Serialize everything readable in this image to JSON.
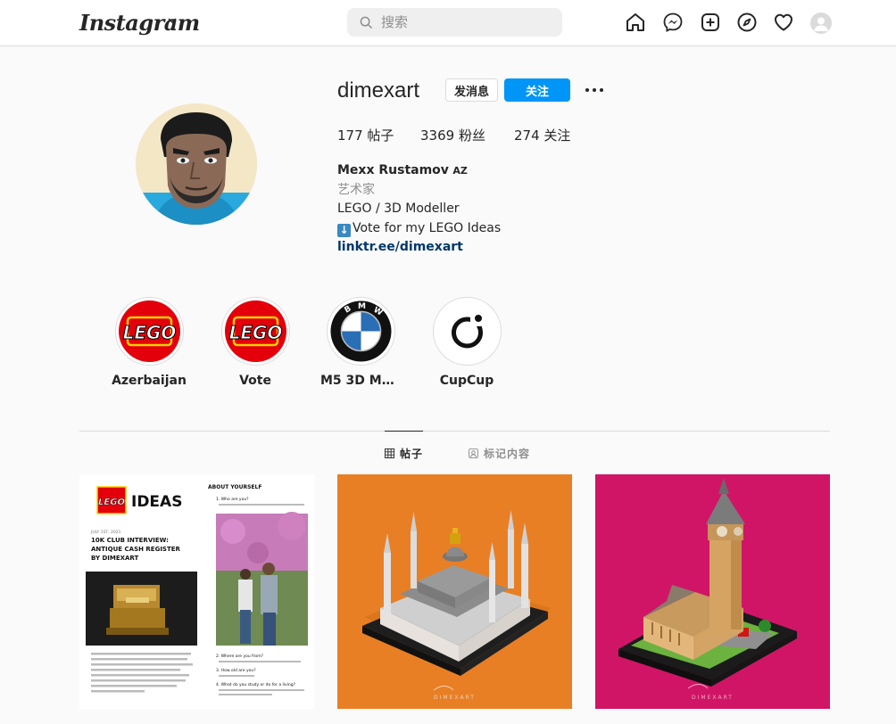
{
  "nav": {
    "logo": "Instagram",
    "search_placeholder": "搜索",
    "icons": [
      "home-icon",
      "messenger-icon",
      "new-post-icon",
      "explore-icon",
      "activity-heart-icon",
      "profile-avatar"
    ]
  },
  "profile": {
    "username": "dimexart",
    "message_button": "发消息",
    "follow_button": "关注",
    "more_icon": "more-options-icon",
    "stats": {
      "posts_count": "177",
      "posts_label": "帖子",
      "followers_count": "3369",
      "followers_label": "粉丝",
      "following_count": "274",
      "following_label": "关注"
    },
    "bio": {
      "full_name": "Mexx Rustamov",
      "flag": "AZ",
      "category": "艺术家",
      "line1": "LEGO / 3D Modeller",
      "line2": "Vote for my LEGO Ideas",
      "link": "linktr.ee/dimexart"
    }
  },
  "highlights": [
    {
      "label": "Azerbaijan",
      "cover": "lego-logo"
    },
    {
      "label": "Vote",
      "cover": "lego-logo"
    },
    {
      "label": "M5 3D Mo...",
      "cover": "bmw-logo"
    },
    {
      "label": "CupCup",
      "cover": "cupcup-logo"
    }
  ],
  "tabs": [
    {
      "label": "帖子",
      "icon": "grid-icon",
      "active": true
    },
    {
      "label": "标记内容",
      "icon": "tagged-icon",
      "active": false
    }
  ],
  "posts": {
    "post1": {
      "brand_box": "LEGO",
      "brand_word": "IDEAS",
      "header": "ABOUT YOURSELF",
      "date": "JULY 1ST, 2021",
      "title_line1": "10K CLUB INTERVIEW:",
      "title_line2": "ANTIQUE CASH REGISTER",
      "title_line3": "BY DIMEXART",
      "q1": "1. Who are you?",
      "q2": "2. Where are you from?",
      "q3": "3. How old are you?",
      "q4": "4. What do you study or do for a living?"
    },
    "post2": {
      "watermark": "DIMEXART",
      "bg": "#e87f25"
    },
    "post3": {
      "watermark": "DIMEXART",
      "bg": "#d01566"
    }
  },
  "colors": {
    "accent": "#0095f6",
    "link": "#00376b",
    "lego_red": "#e3000b",
    "lego_yellow": "#ffcf00"
  }
}
